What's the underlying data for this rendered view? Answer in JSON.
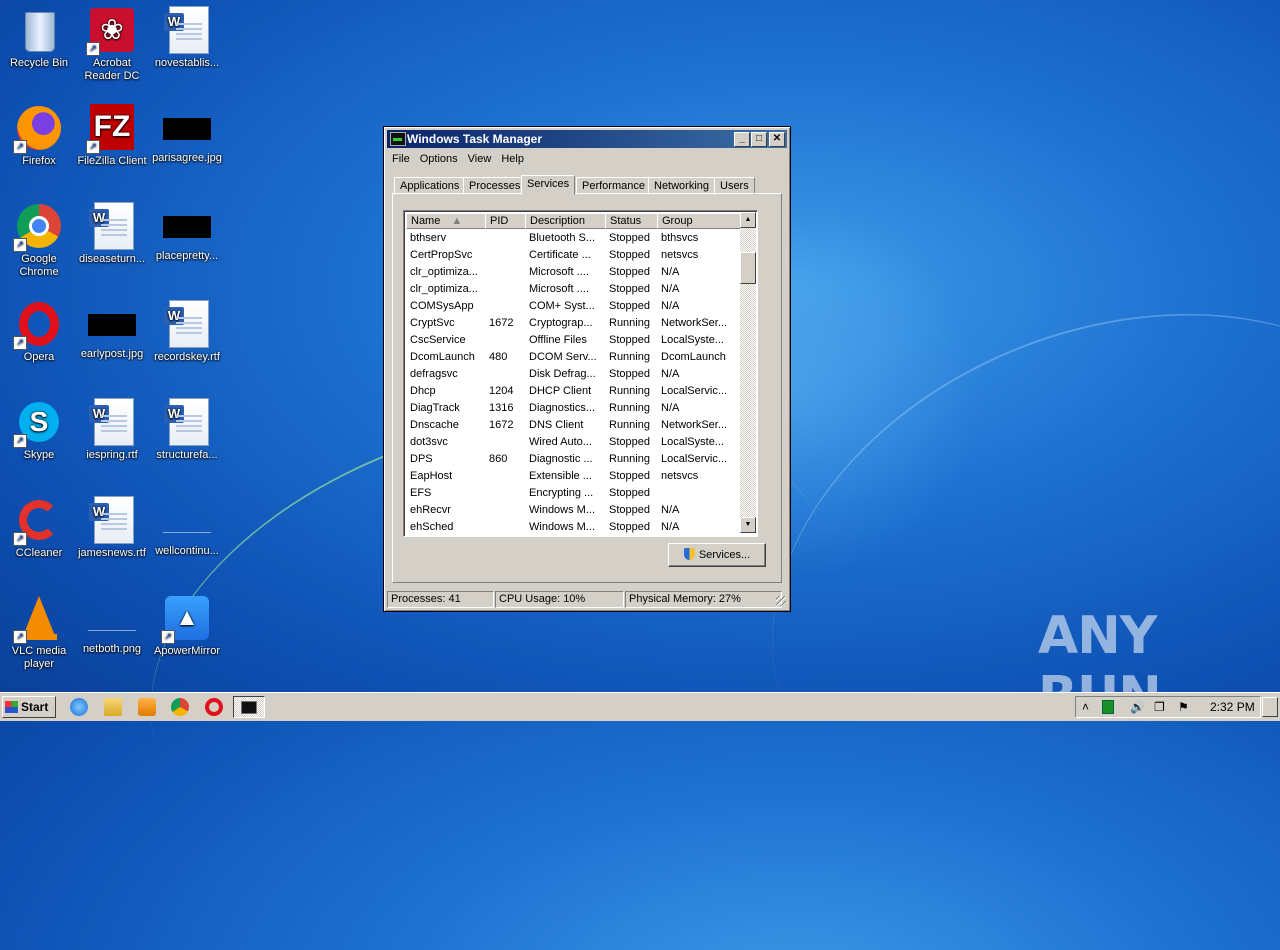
{
  "desktop": {
    "icons": [
      {
        "label": "Recycle Bin",
        "icon": "recycle-bin-icon"
      },
      {
        "label": "Acrobat Reader DC",
        "label_line1": "Acrobat",
        "label_line2": "Reader DC",
        "icon": "acrobat-icon"
      },
      {
        "label": "novestablis...",
        "icon": "word-doc-icon"
      },
      {
        "label": "Firefox",
        "icon": "firefox-icon"
      },
      {
        "label": "FileZilla Client",
        "icon": "filezilla-icon"
      },
      {
        "label": "parisagree.jpg",
        "icon": "image-file-icon"
      },
      {
        "label": "Google Chrome",
        "label_line1": "Google",
        "label_line2": "Chrome",
        "icon": "chrome-icon"
      },
      {
        "label": "diseaseturn...",
        "icon": "word-doc-icon"
      },
      {
        "label": "placepretty...",
        "icon": "image-file-icon"
      },
      {
        "label": "Opera",
        "icon": "opera-icon"
      },
      {
        "label": "earlypost.jpg",
        "icon": "image-file-icon"
      },
      {
        "label": "recordskey.rtf",
        "icon": "word-doc-icon"
      },
      {
        "label": "Skype",
        "icon": "skype-icon"
      },
      {
        "label": "iespring.rtf",
        "icon": "word-doc-icon"
      },
      {
        "label": "structurefa...",
        "icon": "word-doc-icon"
      },
      {
        "label": "CCleaner",
        "icon": "ccleaner-icon"
      },
      {
        "label": "jamesnews.rtf",
        "icon": "word-doc-icon"
      },
      {
        "label": "wellcontinu...",
        "icon": "image-file-icon"
      },
      {
        "label": "VLC media player",
        "label_line1": "VLC media",
        "label_line2": "player",
        "icon": "vlc-icon"
      },
      {
        "label": "netboth.png",
        "icon": "image-file-icon"
      },
      {
        "label": "ApowerMirror",
        "icon": "apowermirror-icon"
      }
    ]
  },
  "window": {
    "title": "Windows Task Manager",
    "menu": [
      "File",
      "Options",
      "View",
      "Help"
    ],
    "tabs": [
      "Applications",
      "Processes",
      "Services",
      "Performance",
      "Networking",
      "Users"
    ],
    "active_tab": "Services",
    "columns": [
      "Name",
      "PID",
      "Description",
      "Status",
      "Group"
    ],
    "rows": [
      [
        "bthserv",
        "",
        "Bluetooth S...",
        "Stopped",
        "bthsvcs"
      ],
      [
        "CertPropSvc",
        "",
        "Certificate ...",
        "Stopped",
        "netsvcs"
      ],
      [
        "clr_optimiza...",
        "",
        "Microsoft ....",
        "Stopped",
        "N/A"
      ],
      [
        "clr_optimiza...",
        "",
        "Microsoft ....",
        "Stopped",
        "N/A"
      ],
      [
        "COMSysApp",
        "",
        "COM+ Syst...",
        "Stopped",
        "N/A"
      ],
      [
        "CryptSvc",
        "1672",
        "Cryptograp...",
        "Running",
        "NetworkSer..."
      ],
      [
        "CscService",
        "",
        "Offline Files",
        "Stopped",
        "LocalSyste..."
      ],
      [
        "DcomLaunch",
        "480",
        "DCOM Serv...",
        "Running",
        "DcomLaunch"
      ],
      [
        "defragsvc",
        "",
        "Disk Defrag...",
        "Stopped",
        "N/A"
      ],
      [
        "Dhcp",
        "1204",
        "DHCP Client",
        "Running",
        "LocalServic..."
      ],
      [
        "DiagTrack",
        "1316",
        "Diagnostics...",
        "Running",
        "N/A"
      ],
      [
        "Dnscache",
        "1672",
        "DNS Client",
        "Running",
        "NetworkSer..."
      ],
      [
        "dot3svc",
        "",
        "Wired Auto...",
        "Stopped",
        "LocalSyste..."
      ],
      [
        "DPS",
        "860",
        "Diagnostic ...",
        "Running",
        "LocalServic..."
      ],
      [
        "EapHost",
        "",
        "Extensible ...",
        "Stopped",
        "netsvcs"
      ],
      [
        "EFS",
        "",
        "Encrypting ...",
        "Stopped",
        ""
      ],
      [
        "ehRecvr",
        "",
        "Windows M...",
        "Stopped",
        "N/A"
      ],
      [
        "ehSched",
        "",
        "Windows M...",
        "Stopped",
        "N/A"
      ]
    ],
    "services_button": "Services...",
    "status": {
      "processes": "Processes: 41",
      "cpu": "CPU Usage: 10%",
      "memory": "Physical Memory: 27%"
    }
  },
  "taskbar": {
    "start_label": "Start",
    "clock": "2:32 PM"
  },
  "watermark": "ANY RUN"
}
